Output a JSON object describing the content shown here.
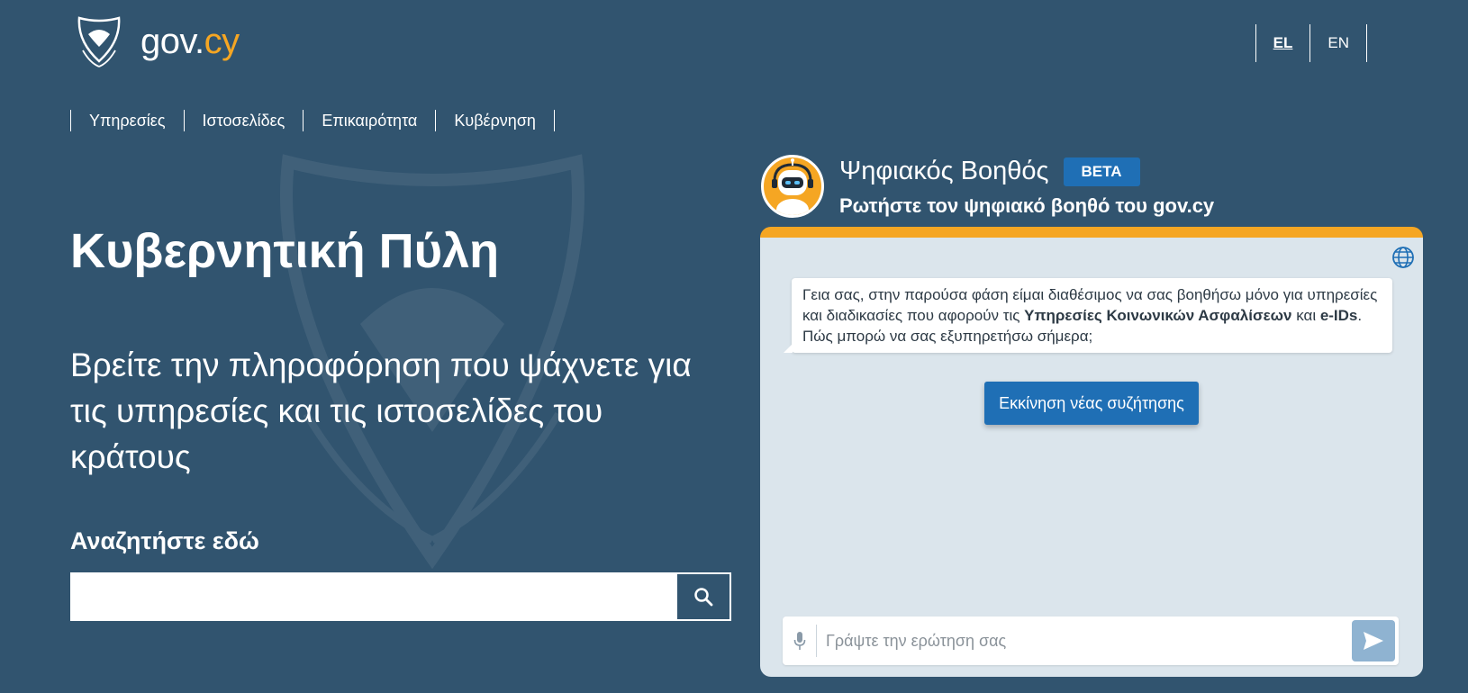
{
  "header": {
    "logo_text_main": "gov.",
    "logo_text_accent": "cy",
    "languages": [
      {
        "label": "EL",
        "active": true
      },
      {
        "label": "EN",
        "active": false
      }
    ]
  },
  "nav": {
    "items": [
      "Υπηρεσίες",
      "Ιστοσελίδες",
      "Επικαιρότητα",
      "Κυβέρνηση"
    ]
  },
  "hero": {
    "title": "Κυβερνητική Πύλη",
    "subtitle": "Βρείτε την πληροφόρηση που ψάχνετε για τις υπηρεσίες και τις ιστοσελίδες του κράτους",
    "search_label": "Αναζητήστε εδώ",
    "search_value": ""
  },
  "chatbot": {
    "title": "Ψηφιακός Βοηθός",
    "badge": "BETA",
    "subtitle": "Ρωτήστε τον ψηφιακό βοηθό του gov.cy",
    "message_part1": "Γεια σας, στην παρούσα φάση είμαι διαθέσιμος να σας βοηθήσω μόνο για υπηρεσίες και διαδικασίες που αφορούν τις ",
    "message_bold1": "Υπηρεσίες Κοινωνικών Ασφαλίσεων",
    "message_part2": " και ",
    "message_bold2": "e-IDs",
    "message_part3": ". Πώς μπορώ να σας εξυπηρετήσω σήμερα;",
    "new_chat_button": "Εκκίνηση νέας συζήτησης",
    "input_placeholder": "Γράψτε την ερώτηση σας"
  },
  "colors": {
    "background": "#31546f",
    "accent": "#f5a623",
    "button_blue": "#1f6fb5",
    "chat_panel": "#dbe5ec"
  }
}
